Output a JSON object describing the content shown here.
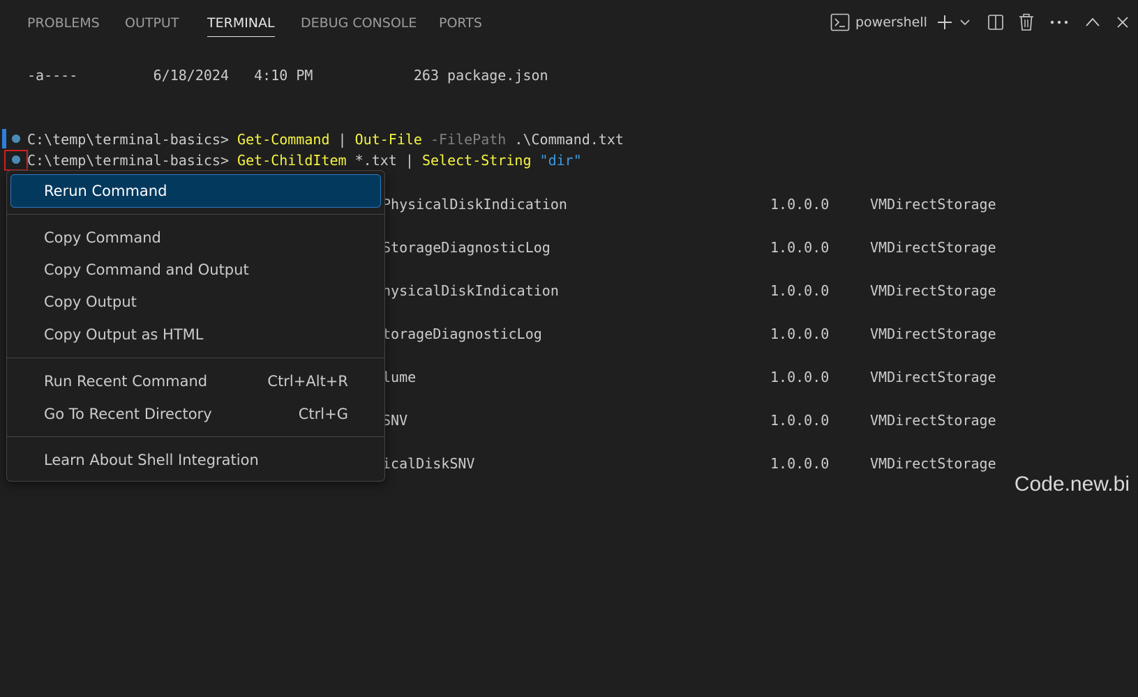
{
  "tabs": [
    {
      "label": "PROBLEMS"
    },
    {
      "label": "OUTPUT"
    },
    {
      "label": "TERMINAL"
    },
    {
      "label": "DEBUG CONSOLE"
    },
    {
      "label": "PORTS"
    }
  ],
  "actions": {
    "shell_name": "powershell",
    "icons": [
      "terminal-icon",
      "plus-icon",
      "chevron-down-icon",
      "split-icon",
      "trash-icon",
      "more-icon",
      "chevron-up-icon",
      "close-icon"
    ]
  },
  "terminal": {
    "listing_line": "-a----         6/18/2024   4:10 PM            263 package.json",
    "prompt": "C:\\temp\\terminal-basics> ",
    "cmd1": {
      "c1": "Get-Command",
      "pipe": " | ",
      "c2": "Out-File",
      "param": " -FilePath",
      "arg": " .\\Command.txt"
    },
    "cmd2": {
      "c1": "Get-ChildItem",
      "arg1": " *.txt",
      "pipe": " | ",
      "c2": "Select-String",
      "str": " \"dir\""
    },
    "rows": [
      {
        "name": "PhysicalDiskIndication",
        "version": "1.0.0.0",
        "source": "VMDirectStorage"
      },
      {
        "name": "StorageDiagnosticLog",
        "version": "1.0.0.0",
        "source": "VMDirectStorage"
      },
      {
        "name": "hysicalDiskIndication",
        "version": "1.0.0.0",
        "source": "VMDirectStorage"
      },
      {
        "name": "torageDiagnosticLog",
        "version": "1.0.0.0",
        "source": "VMDirectStorage"
      },
      {
        "name": "lume",
        "version": "1.0.0.0",
        "source": "VMDirectStorage"
      },
      {
        "name": "SNV",
        "version": "1.0.0.0",
        "source": "VMDirectStorage"
      },
      {
        "name": "icalDiskSNV",
        "version": "1.0.0.0",
        "source": "VMDirectStorage"
      }
    ]
  },
  "menu": {
    "items": [
      {
        "label": "Rerun Command",
        "shortcut": ""
      },
      {
        "label": "Copy Command",
        "shortcut": ""
      },
      {
        "label": "Copy Command and Output",
        "shortcut": ""
      },
      {
        "label": "Copy Output",
        "shortcut": ""
      },
      {
        "label": "Copy Output as HTML",
        "shortcut": ""
      },
      {
        "label": "Run Recent Command",
        "shortcut": "Ctrl+Alt+R"
      },
      {
        "label": "Go To Recent Directory",
        "shortcut": "Ctrl+G"
      },
      {
        "label": "Learn About Shell Integration",
        "shortcut": ""
      }
    ]
  },
  "watermark": "Code.new.bi",
  "colors": {
    "background": "#1f1f1f",
    "command_yellow": "#f5f543",
    "string_blue": "#3b9be0",
    "menu_selected": "#04395e",
    "highlight_red": "#d22020"
  }
}
